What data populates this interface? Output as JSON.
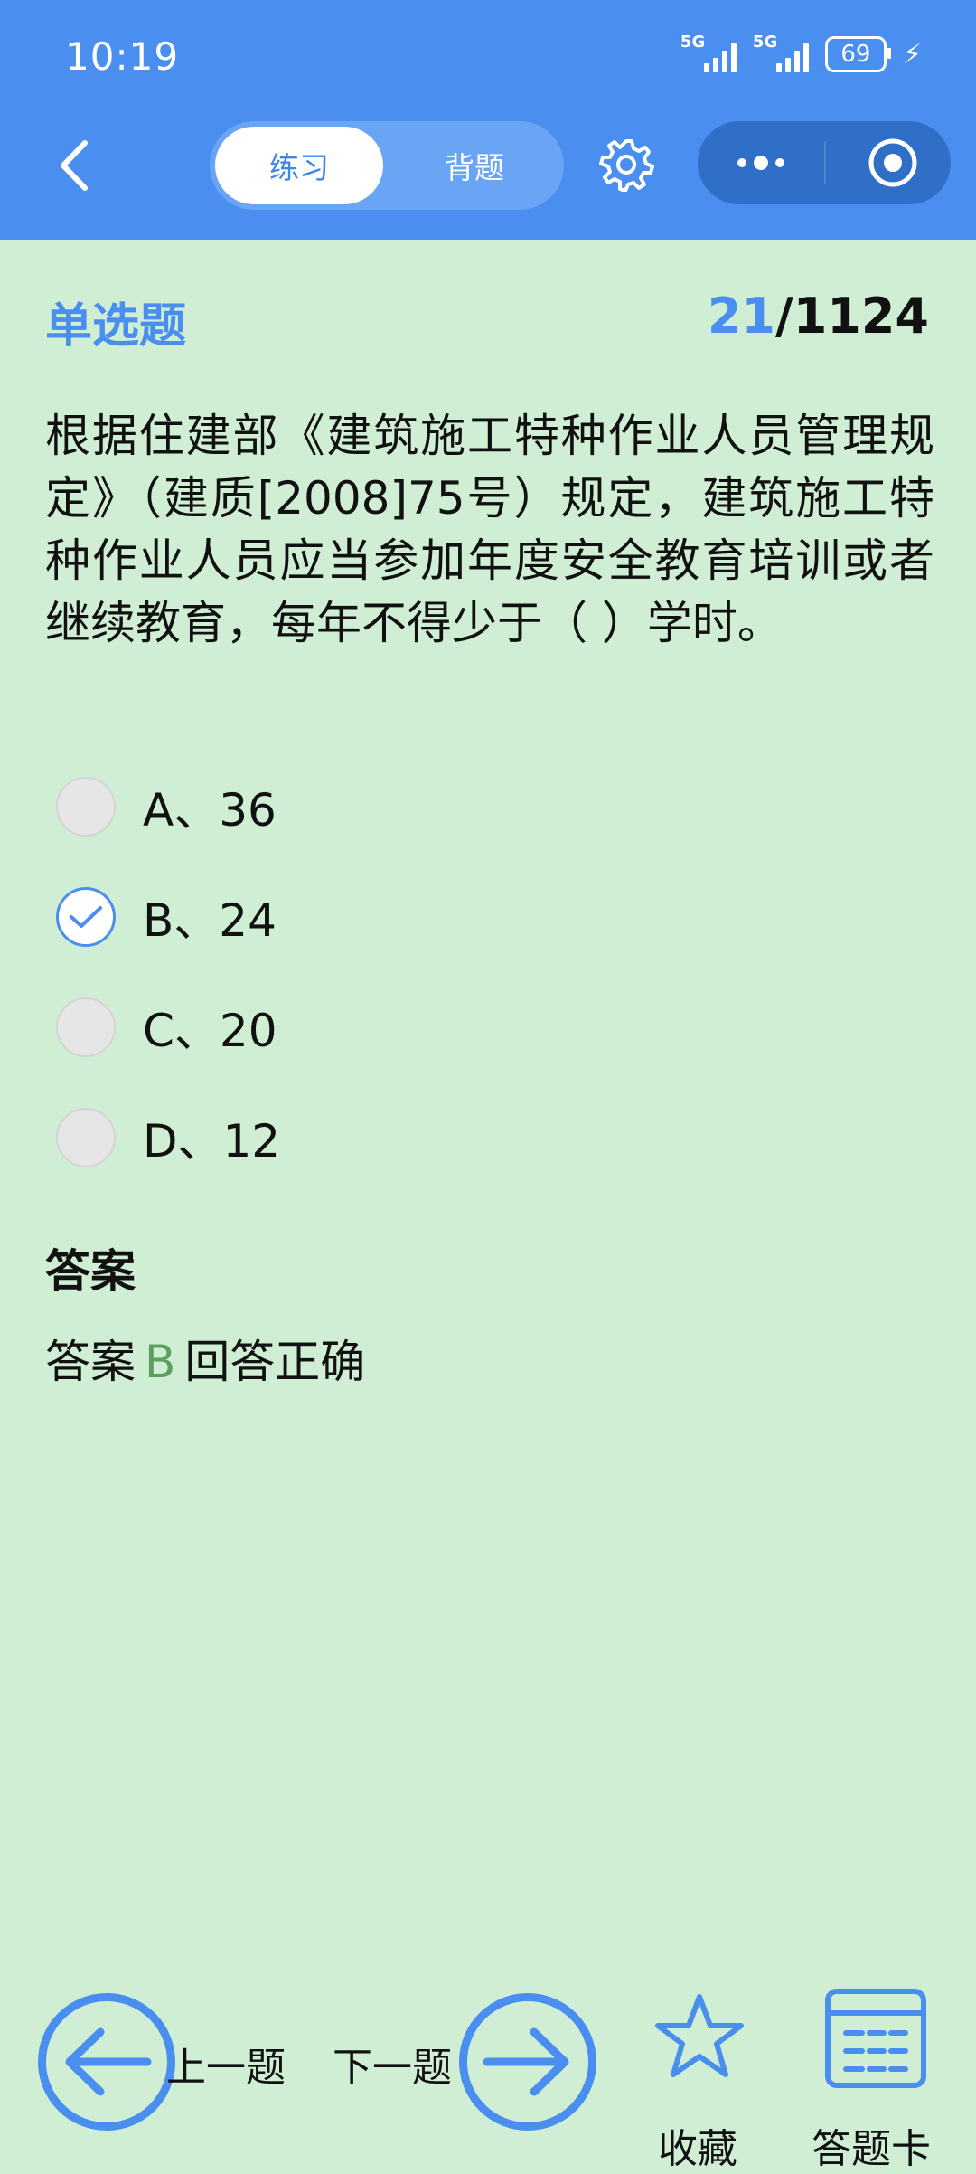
{
  "status": {
    "time": "10:19",
    "signal1": "5G",
    "signal2": "5G",
    "battery": "69"
  },
  "header": {
    "tab_practice": "练习",
    "tab_memorize": "背题",
    "active_tab": "练习"
  },
  "question": {
    "type": "单选题",
    "current": "21",
    "total": "/1124",
    "text": "根据住建部《建筑施工特种作业人员管理规定》（建质[2008]75号）规定，建筑施工特种作业人员应当参加年度安全教育培训或者继续教育，每年不得少于（ ）学时。",
    "options": [
      {
        "label": "A、36",
        "selected": false
      },
      {
        "label": "B、24",
        "selected": true
      },
      {
        "label": "C、20",
        "selected": false
      },
      {
        "label": "D、12",
        "selected": false
      }
    ]
  },
  "answer": {
    "title": "答案",
    "prefix": "答案",
    "letter": "B",
    "result": "回答正确"
  },
  "bottom_bar": {
    "prev_label": "上一题",
    "next_label": "下一题",
    "favorite_label": "收藏",
    "card_label": "答题卡"
  },
  "colors": {
    "accent": "#4a8ff0",
    "background": "#cfeed3",
    "correct": "#5da05e"
  }
}
